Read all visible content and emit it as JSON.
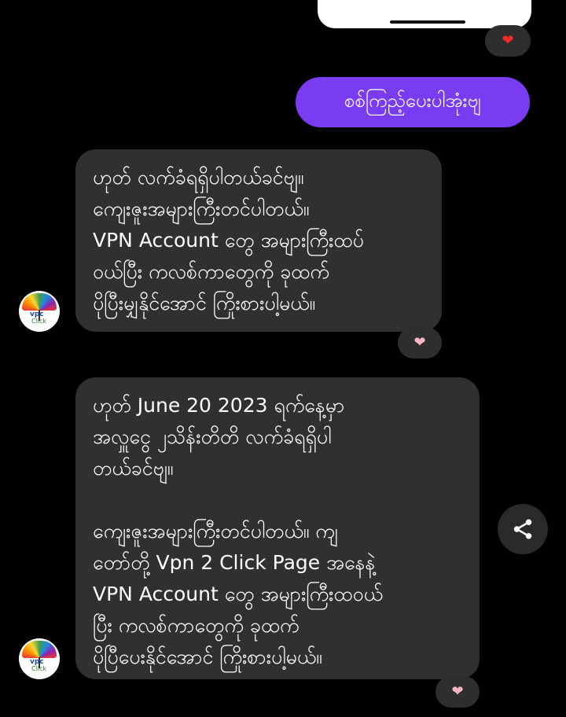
{
  "top_message": {
    "reaction": "❤"
  },
  "sent_message": {
    "text": "စစ်ကြည့်ပေးပါအုံးဗျ"
  },
  "received_messages": [
    {
      "lines": [
        "ဟုတ် လက်ခံရရှိပါတယ်ခင်ဗျ။",
        "ကျေးဇူးအများကြီးတင်ပါတယ်။",
        "VPN Account တွေ အများကြီးထပ်",
        "ဝယ်ပြီး ကလစ်ကာတွေကို ခုထက်",
        "ပိုပြီးမျှနိုင်အောင် ကြိုးစားပါ့မယ်။"
      ],
      "reaction": "❤"
    },
    {
      "lines": [
        "ဟုတ် June 20 2023 ရက်နေ့မှာ",
        "အလှူငွေ ၂သိန်းတိတိ လက်ခံရရှိပါ",
        "တယ်ခင်ဗျ။",
        "",
        "ကျေးဇူးအများကြီးတင်ပါတယ်။ ကျ",
        "တော်တို့ Vpn 2 Click Page အနေနဲ့",
        "VPN Account တွေ အများကြီးထဝယ်",
        "ပြီး ကလစ်ကာတွေကို ခုထက်",
        "ပိုပြီပေးနိုင်အောင် ကြိုးစားပါ့မယ်။"
      ],
      "reaction": "❤"
    }
  ],
  "avatar": {
    "logo_text": "vpc",
    "logo_text2": "Click"
  },
  "colors": {
    "background": "#000000",
    "sent_bubble": "#7a3cf1",
    "received_bubble": "#303030",
    "reaction_pill": "#2e2e2e",
    "heart_red": "#f12a2a",
    "heart_pink": "#f7b6c6"
  },
  "icons": {
    "share": "share-icon",
    "heart": "heart-icon"
  }
}
